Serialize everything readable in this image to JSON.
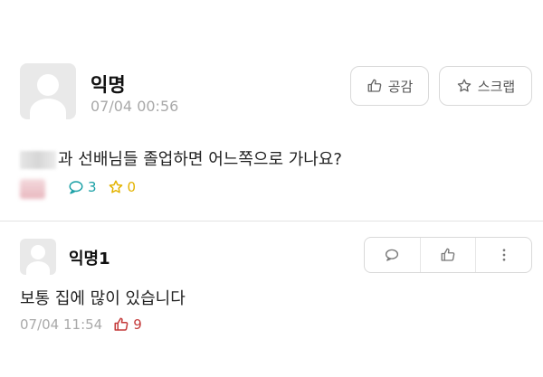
{
  "post": {
    "author": "익명",
    "time": "07/04 00:56",
    "body_text": "과 선배님들 졸업하면 어느쪽으로 가나요?",
    "comments_count": "3",
    "scraps_count": "0",
    "actions": {
      "like_label": "공감",
      "scrap_label": "스크랩"
    }
  },
  "comment": {
    "author": "익명1",
    "body": "보통 집에 많이 있습니다",
    "time": "07/04 11:54",
    "likes": "9"
  },
  "colors": {
    "comment_count": "#1aa0a6",
    "scrap_count": "#e3b300",
    "comment_like": "#c43a3a",
    "muted": "#a9a9a9"
  },
  "icons": [
    "thumbs-up-icon",
    "star-icon",
    "speech-bubble-icon",
    "more-vertical-icon",
    "default-avatar-icon"
  ]
}
